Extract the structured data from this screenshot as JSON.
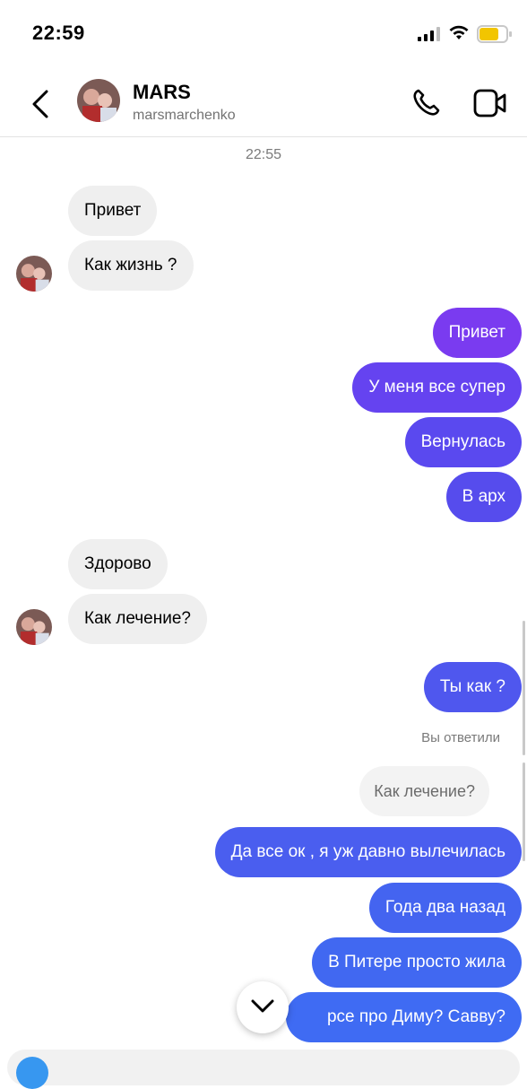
{
  "status": {
    "time": "22:59"
  },
  "header": {
    "name": "MARS",
    "username": "marsmarchenko"
  },
  "chat": {
    "timestamp": "22:55",
    "incoming_1": [
      "Привет",
      "Как жизнь ?"
    ],
    "outgoing_1": [
      "Привет",
      "У меня все супер",
      "Вернулась",
      "В арх"
    ],
    "incoming_2": [
      "Здорово",
      "Как лечение?"
    ],
    "outgoing_2": [
      "Ты как ?"
    ],
    "reply_label": "Вы ответили",
    "replied_to": "Как лечение?",
    "outgoing_3": [
      "Да все ок , я уж давно вылечилась",
      "Года два назад",
      "В Питере просто жила",
      "рсе про Диму? Савву?"
    ]
  },
  "colors": {
    "incoming_bubble": "#efefef",
    "outgoing_gradient": [
      "#7a3bf0",
      "#5a49ef",
      "#4f57ee",
      "#3f6bf3"
    ]
  },
  "icons": [
    "back-chevron-icon",
    "phone-icon",
    "video-camera-icon",
    "chevron-down-icon"
  ]
}
